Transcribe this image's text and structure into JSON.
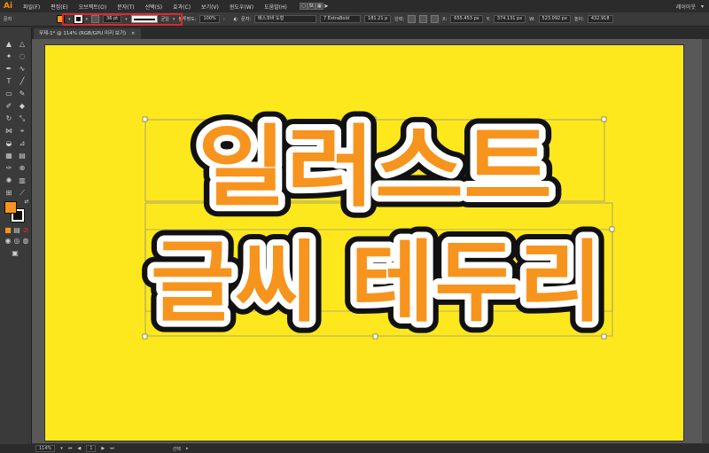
{
  "app": {
    "logo": "Ai",
    "workspace": "레이아웃"
  },
  "menu": [
    "파일(F)",
    "편집(E)",
    "오브젝트(O)",
    "문자(T)",
    "선택(S)",
    "효과(C)",
    "보기(V)",
    "윈도우(W)",
    "도움말(H)"
  ],
  "control": {
    "context_label": "문자",
    "stroke_weight": "36 pt",
    "stroke_style": "균일",
    "opacity_label": "불투명도:",
    "opacity_value": "100%",
    "char_label": "문자:",
    "font_family": "배스코바 도형",
    "font_style": "7 ExtraBold",
    "font_size": "181.21 p",
    "para_label": "단락:",
    "x_label": "X:",
    "x_value": "655.453 px",
    "y_label": "Y:",
    "y_value": "374.131 px",
    "w_label": "W:",
    "w_value": "523.092 px",
    "h_label": "높이:",
    "h_value": "432.918"
  },
  "document": {
    "tab_title": "무제-1* @ 114% (RGB/GPU 미리 보기)",
    "close_glyph": "×"
  },
  "artwork": {
    "line1": "일러스트",
    "line2": "글씨 테두리"
  },
  "status": {
    "zoom": "114%",
    "page": "1",
    "tool_name": "선택"
  },
  "colors": {
    "fill": "#f7941d",
    "stroke": "#111111",
    "inner_stroke": "#ffffff",
    "artboard": "#fde81d",
    "highlight": "#e0272b"
  }
}
